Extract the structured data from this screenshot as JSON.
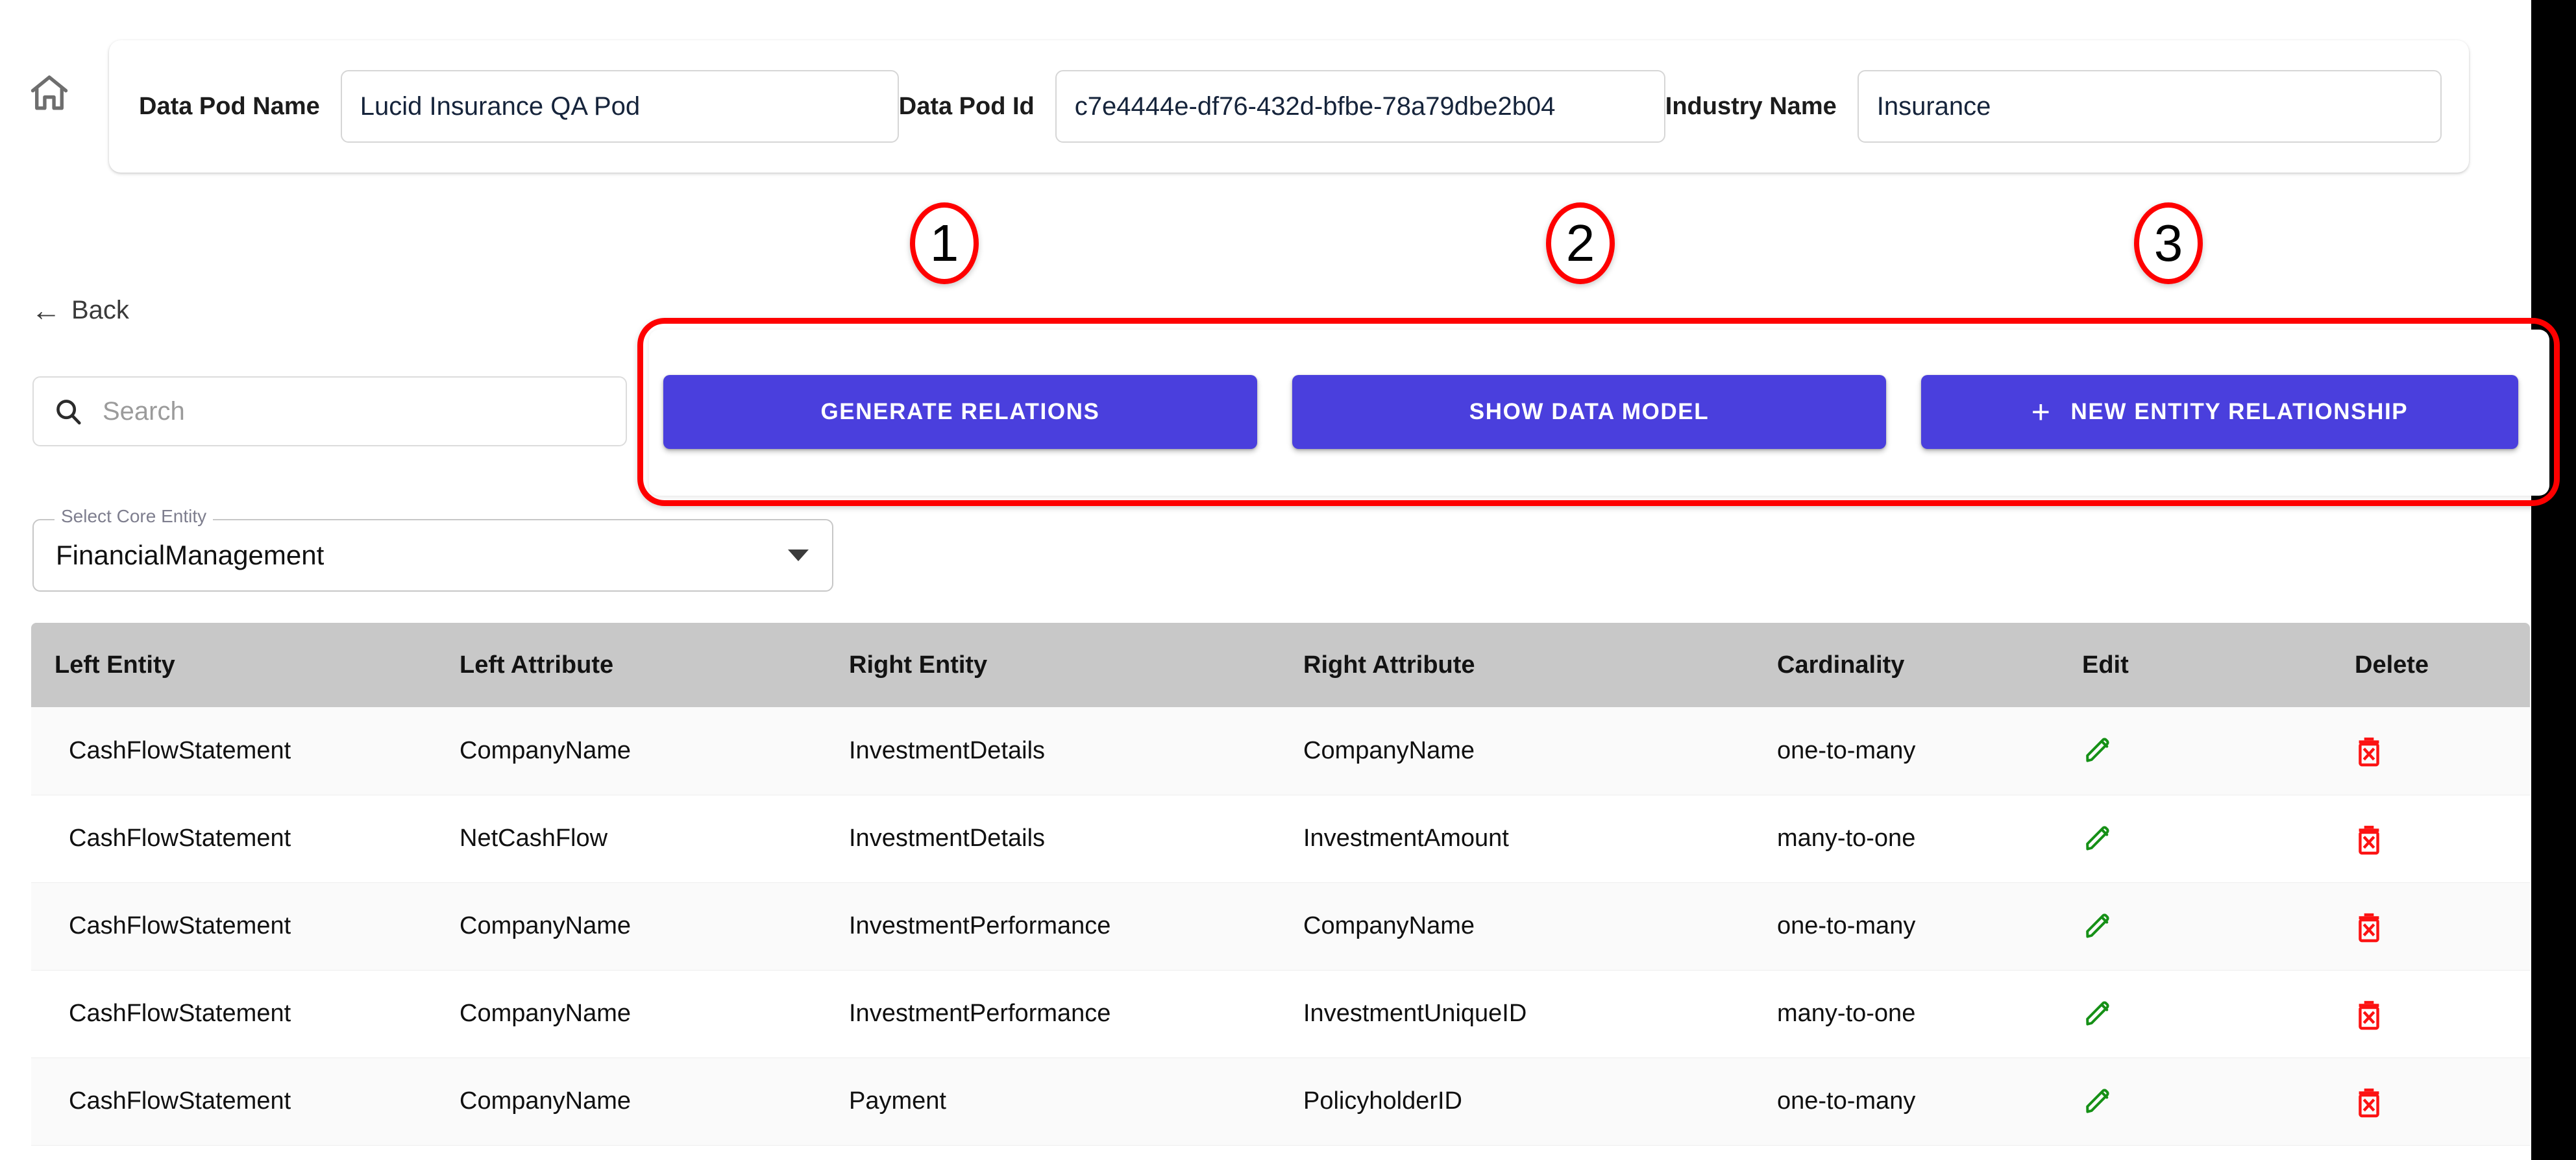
{
  "header": {
    "home_icon": "home-icon",
    "fields": [
      {
        "label": "Data Pod Name",
        "value": "Lucid Insurance QA Pod"
      },
      {
        "label": "Data Pod Id",
        "value": "c7e4444e-df76-432d-bfbe-78a79dbe2b04"
      },
      {
        "label": "Industry Name",
        "value": "Insurance"
      }
    ]
  },
  "annotations": {
    "accent_color": "#fe0000",
    "markers": [
      {
        "number": "1"
      },
      {
        "number": "2"
      },
      {
        "number": "3"
      }
    ]
  },
  "nav": {
    "back_label": "Back",
    "back_arrow_icon": "arrow-left-icon"
  },
  "search": {
    "icon": "search-icon",
    "placeholder": "Search",
    "value": ""
  },
  "toolbar": {
    "accent_color": "#4a3fdd",
    "generate_relations_label": "GENERATE RELATIONS",
    "show_data_model_label": "SHOW DATA MODEL",
    "new_entity_relationship_label": "NEW ENTITY RELATIONSHIP",
    "plus_icon": "plus-icon"
  },
  "core_entity_select": {
    "legend": "Select Core Entity",
    "value": "FinancialManagement",
    "caret_icon": "chevron-down-icon"
  },
  "table": {
    "header_bg": "#c8c8c8",
    "columns": [
      "Left Entity",
      "Left Attribute",
      "Right Entity",
      "Right Attribute",
      "Cardinality",
      "Edit",
      "Delete"
    ],
    "edit_icon": "pencil-icon",
    "edit_icon_color": "#159016",
    "delete_icon": "trash-x-icon",
    "delete_icon_color": "#fc1313",
    "rows": [
      {
        "left_entity": "CashFlowStatement",
        "left_attribute": "CompanyName",
        "right_entity": "InvestmentDetails",
        "right_attribute": "CompanyName",
        "cardinality": "one-to-many"
      },
      {
        "left_entity": "CashFlowStatement",
        "left_attribute": "NetCashFlow",
        "right_entity": "InvestmentDetails",
        "right_attribute": "InvestmentAmount",
        "cardinality": "many-to-one"
      },
      {
        "left_entity": "CashFlowStatement",
        "left_attribute": "CompanyName",
        "right_entity": "InvestmentPerformance",
        "right_attribute": "CompanyName",
        "cardinality": "one-to-many"
      },
      {
        "left_entity": "CashFlowStatement",
        "left_attribute": "CompanyName",
        "right_entity": "InvestmentPerformance",
        "right_attribute": "InvestmentUniqueID",
        "cardinality": "many-to-one"
      },
      {
        "left_entity": "CashFlowStatement",
        "left_attribute": "CompanyName",
        "right_entity": "Payment",
        "right_attribute": "PolicyholderID",
        "cardinality": "one-to-many"
      }
    ]
  }
}
